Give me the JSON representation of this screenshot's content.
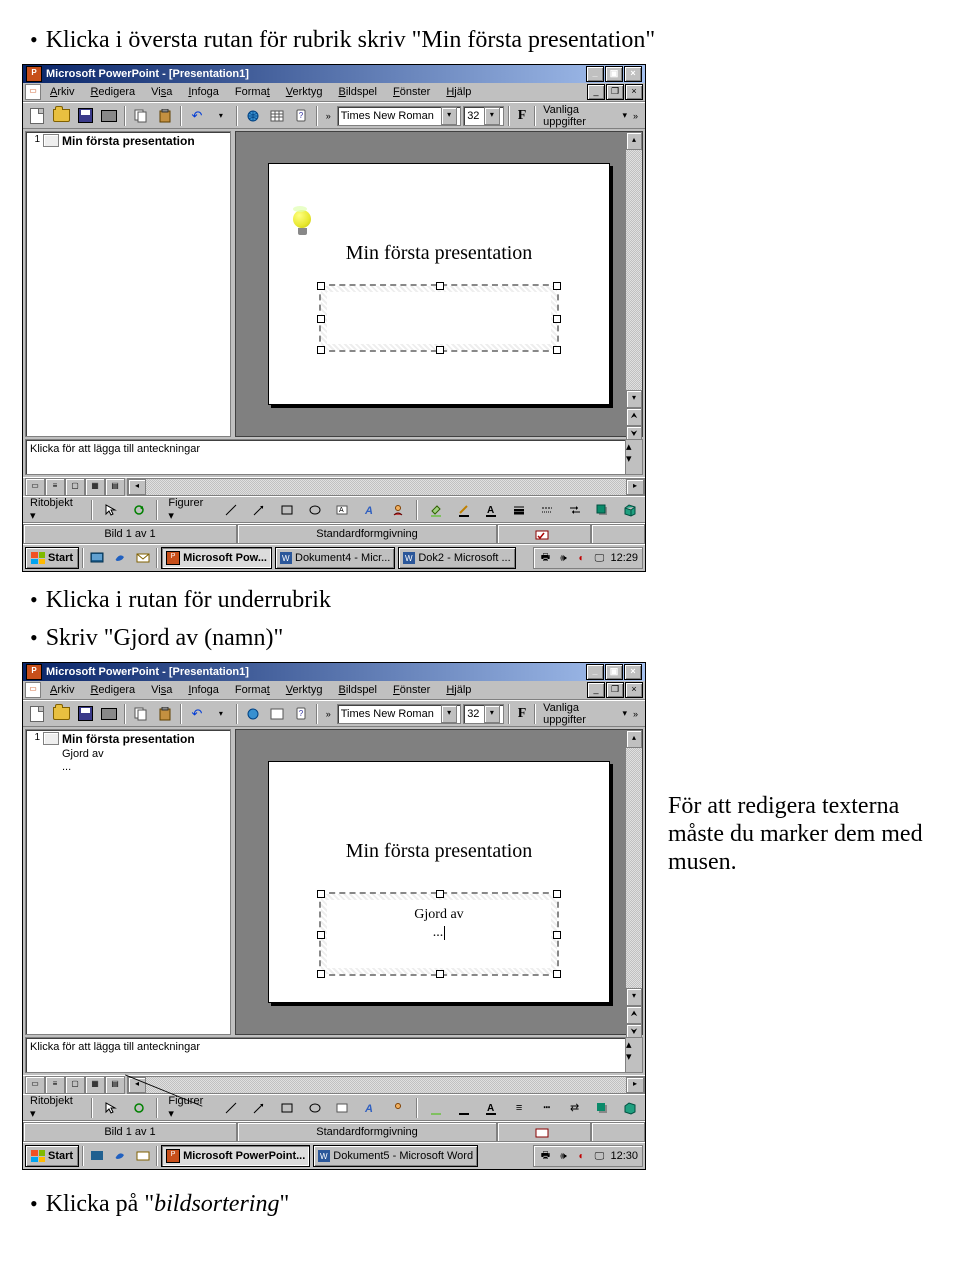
{
  "bullets": {
    "b1": "Klicka i översta rutan för rubrik skriv \"Min första presentation\"",
    "b2": "Klicka i rutan för underrubrik",
    "b3": "Skriv \"Gjord av (namn)\"",
    "b4_pre": "Klicka på \"",
    "b4_ital": "bildsortering",
    "b4_post": "\""
  },
  "side_note": "För att redigera texterna måste du marker dem med musen.",
  "app": {
    "title": "Microsoft PowerPoint - [Presentation1]",
    "menus": {
      "arkiv": "Arkiv",
      "redigera": "Redigera",
      "visa": "Visa",
      "infoga": "Infoga",
      "format": "Format",
      "verktyg": "Verktyg",
      "bildspel": "Bildspel",
      "fonster": "Fönster",
      "hjalp": "Hjälp"
    },
    "toolbar": {
      "font": "Times New Roman",
      "size": "32",
      "bold": "F",
      "vanliga": "Vanliga uppgifter"
    },
    "outline": {
      "num": "1",
      "title": "Min första presentation",
      "sub1": "Gjord av",
      "sub2": "..."
    },
    "slide": {
      "title": "Min första presentation",
      "sub_line1": "Gjord av",
      "sub_line2": "..."
    },
    "notes_placeholder": "Klicka för att lägga till anteckningar",
    "draw": {
      "ritobjekt": "Ritobjekt",
      "figurer": "Figurer"
    },
    "status": {
      "slide": "Bild 1 av 1",
      "design": "Standardformgivning"
    },
    "taskbar": {
      "start": "Start",
      "task1_a": "Microsoft Pow...",
      "task1_b": "Microsoft PowerPoint...",
      "task2_a": "Dokument4 - Micr...",
      "task2_b": "Dokument5 - Microsoft Word",
      "task3": "Dok2 - Microsoft ...",
      "clock_a": "12:29",
      "clock_b": "12:30"
    }
  }
}
